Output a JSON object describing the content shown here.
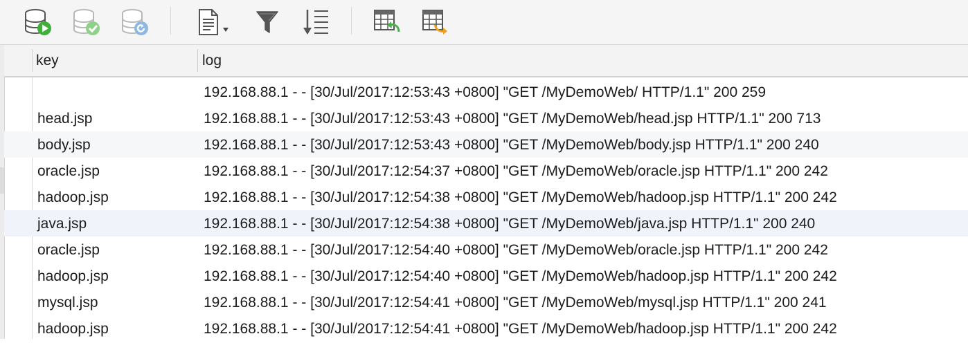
{
  "toolbar": {
    "buttons": [
      {
        "name": "run-query-button",
        "icon": "database-run-icon",
        "enabled": true
      },
      {
        "name": "commit-button",
        "icon": "database-commit-icon",
        "enabled": false
      },
      {
        "name": "rollback-button",
        "icon": "database-rollback-icon",
        "enabled": false
      },
      {
        "name": "export-document-button",
        "icon": "document-dropdown-icon",
        "enabled": true
      },
      {
        "name": "filter-button",
        "icon": "filter-icon",
        "enabled": true
      },
      {
        "name": "sort-button",
        "icon": "sort-icon",
        "enabled": true
      },
      {
        "name": "import-table-button",
        "icon": "table-import-icon",
        "enabled": true
      },
      {
        "name": "export-table-button",
        "icon": "table-export-icon",
        "enabled": true
      }
    ]
  },
  "table": {
    "columns": [
      "key",
      "log"
    ],
    "rows": [
      {
        "key": "",
        "log": "192.168.88.1 - - [30/Jul/2017:12:53:43 +0800] \"GET /MyDemoWeb/ HTTP/1.1\" 200 259"
      },
      {
        "key": "head.jsp",
        "log": "192.168.88.1 - - [30/Jul/2017:12:53:43 +0800] \"GET /MyDemoWeb/head.jsp HTTP/1.1\" 200 713"
      },
      {
        "key": "body.jsp",
        "log": "192.168.88.1 - - [30/Jul/2017:12:53:43 +0800] \"GET /MyDemoWeb/body.jsp HTTP/1.1\" 200 240"
      },
      {
        "key": "oracle.jsp",
        "log": "192.168.88.1 - - [30/Jul/2017:12:54:37 +0800] \"GET /MyDemoWeb/oracle.jsp HTTP/1.1\" 200 242"
      },
      {
        "key": "hadoop.jsp",
        "log": "192.168.88.1 - - [30/Jul/2017:12:54:38 +0800] \"GET /MyDemoWeb/hadoop.jsp HTTP/1.1\" 200 242"
      },
      {
        "key": "java.jsp",
        "log": "192.168.88.1 - - [30/Jul/2017:12:54:38 +0800] \"GET /MyDemoWeb/java.jsp HTTP/1.1\" 200 240"
      },
      {
        "key": "oracle.jsp",
        "log": "192.168.88.1 - - [30/Jul/2017:12:54:40 +0800] \"GET /MyDemoWeb/oracle.jsp HTTP/1.1\" 200 242"
      },
      {
        "key": "hadoop.jsp",
        "log": "192.168.88.1 - - [30/Jul/2017:12:54:40 +0800] \"GET /MyDemoWeb/hadoop.jsp HTTP/1.1\" 200 242"
      },
      {
        "key": "mysql.jsp",
        "log": "192.168.88.1 - - [30/Jul/2017:12:54:41 +0800] \"GET /MyDemoWeb/mysql.jsp HTTP/1.1\" 200 241"
      },
      {
        "key": "hadoop.jsp",
        "log": "192.168.88.1 - - [30/Jul/2017:12:54:41 +0800] \"GET /MyDemoWeb/hadoop.jsp HTTP/1.1\" 200 242"
      }
    ]
  },
  "colors": {
    "run_green": "#3fae3a",
    "check_green": "#8fd08a",
    "rollback_blue": "#8fb8e0",
    "undo_green": "#4caf50",
    "export_orange": "#f0a020",
    "disabled_gray": "#b8b8b8"
  }
}
